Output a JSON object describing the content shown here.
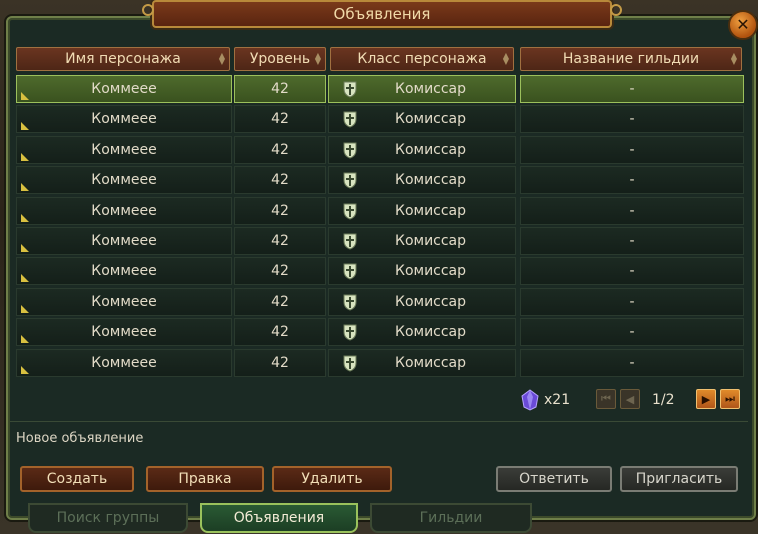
{
  "window": {
    "title": "Объявления"
  },
  "columns": [
    {
      "label": "Имя персонажа"
    },
    {
      "label": "Уровень"
    },
    {
      "label": "Класс персонажа"
    },
    {
      "label": "Название гильдии"
    }
  ],
  "rows": [
    {
      "name": "Коммеее",
      "level": "42",
      "class": "Комиссар",
      "guild": "-",
      "selected": true
    },
    {
      "name": "Коммеее",
      "level": "42",
      "class": "Комиссар",
      "guild": "-"
    },
    {
      "name": "Коммеее",
      "level": "42",
      "class": "Комиссар",
      "guild": "-"
    },
    {
      "name": "Коммеее",
      "level": "42",
      "class": "Комиссар",
      "guild": "-"
    },
    {
      "name": "Коммеее",
      "level": "42",
      "class": "Комиссар",
      "guild": "-"
    },
    {
      "name": "Коммеее",
      "level": "42",
      "class": "Комиссар",
      "guild": "-"
    },
    {
      "name": "Коммеее",
      "level": "42",
      "class": "Комиссар",
      "guild": "-"
    },
    {
      "name": "Коммеее",
      "level": "42",
      "class": "Комиссар",
      "guild": "-"
    },
    {
      "name": "Коммеее",
      "level": "42",
      "class": "Комиссар",
      "guild": "-"
    },
    {
      "name": "Коммеее",
      "level": "42",
      "class": "Комиссар",
      "guild": "-"
    }
  ],
  "currency": {
    "icon": "crystal-icon",
    "amount": "x21"
  },
  "pagination": {
    "current": 1,
    "total": 2,
    "label": "1/2"
  },
  "new_ad": {
    "label": "Новое объявление"
  },
  "buttons": {
    "create": "Создать",
    "edit": "Правка",
    "delete": "Удалить",
    "reply": "Ответить",
    "invite": "Пригласить"
  },
  "tabs": [
    {
      "label": "Поиск группы",
      "active": false
    },
    {
      "label": "Объявления",
      "active": true
    },
    {
      "label": "Гильдии",
      "active": false
    }
  ]
}
